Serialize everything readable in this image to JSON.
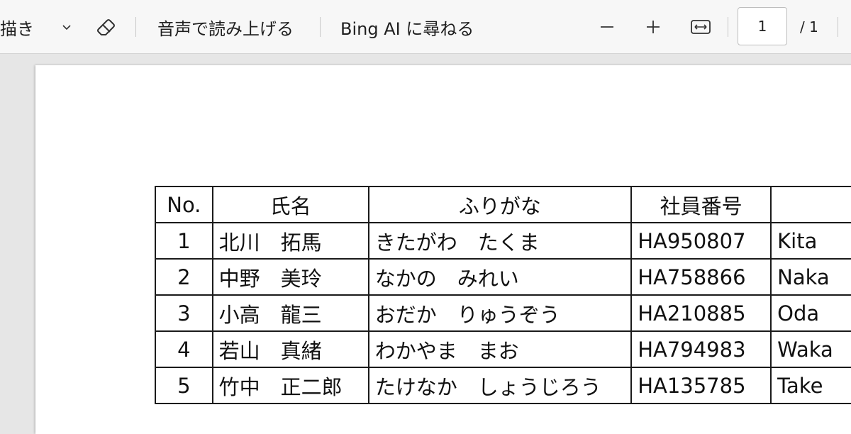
{
  "toolbar": {
    "draw_label": "描き",
    "read_aloud_label": "音声で読み上げる",
    "ask_bing_label": "Bing AI に尋ねる",
    "current_page": "1",
    "total_pages": "/ 1",
    "icons": {
      "draw_dropdown": "chevron-down-icon",
      "eraser": "eraser-icon",
      "zoom_out": "minus-icon",
      "zoom_in": "plus-icon",
      "fit_width": "fit-width-icon"
    }
  },
  "document": {
    "table": {
      "headers": [
        "No.",
        "氏名",
        "ふりがな",
        "社員番号",
        ""
      ],
      "rows": [
        {
          "no": "1",
          "name": "北川　拓馬",
          "kana": "きたがわ　たくま",
          "id": "HA950807",
          "romaji": "Kita"
        },
        {
          "no": "2",
          "name": "中野　美玲",
          "kana": "なかの　みれい",
          "id": "HA758866",
          "romaji": "Naka"
        },
        {
          "no": "3",
          "name": "小高　龍三",
          "kana": "おだか　りゅうぞう",
          "id": "HA210885",
          "romaji": "Oda"
        },
        {
          "no": "4",
          "name": "若山　真緒",
          "kana": "わかやま　まお",
          "id": "HA794983",
          "romaji": "Waka"
        },
        {
          "no": "5",
          "name": "竹中　正二郎",
          "kana": "たけなか　しょうじろう",
          "id": "HA135785",
          "romaji": "Take"
        }
      ]
    }
  }
}
